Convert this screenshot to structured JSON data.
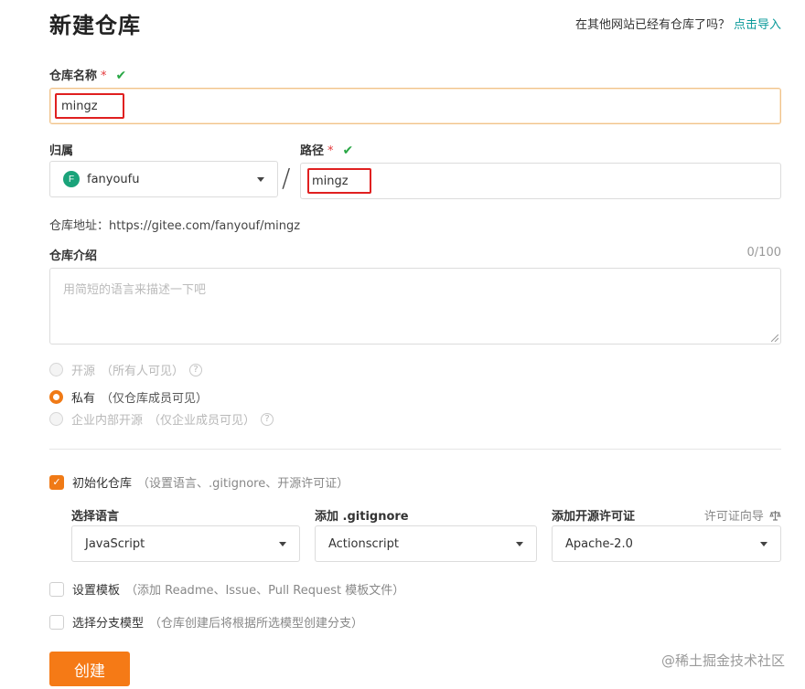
{
  "header": {
    "title": "新建仓库",
    "import_hint": "在其他网站已经有仓库了吗？",
    "import_link": "点击导入"
  },
  "repo_name": {
    "label": "仓库名称",
    "required_mark": "*",
    "valid_mark": "✔",
    "value": "mingz"
  },
  "owner": {
    "label": "归属",
    "avatar_letter": "F",
    "value": "fanyoufu"
  },
  "path_separator": "/",
  "path": {
    "label": "路径",
    "required_mark": "*",
    "valid_mark": "✔",
    "value": "mingz"
  },
  "address": {
    "label": "仓库地址：",
    "value": "https://gitee.com/fanyouf/mingz"
  },
  "intro": {
    "label": "仓库介绍",
    "counter": "0/100",
    "placeholder": "用简短的语言来描述一下吧"
  },
  "visibility": {
    "options": [
      {
        "label": "开源",
        "hint": "（所有人可见）",
        "state": "disabled",
        "has_help": true
      },
      {
        "label": "私有",
        "hint": "（仅仓库成员可见）",
        "state": "checked",
        "has_help": false
      },
      {
        "label": "企业内部开源",
        "hint": "（仅企业成员可见）",
        "state": "disabled",
        "has_help": true
      }
    ],
    "help_glyph": "?"
  },
  "init": {
    "label": "初始化仓库",
    "hint": "（设置语言、.gitignore、开源许可证）",
    "checked": true,
    "language": {
      "label": "选择语言",
      "value": "JavaScript"
    },
    "gitignore": {
      "label": "添加 .gitignore",
      "value": "Actionscript"
    },
    "license": {
      "label": "添加开源许可证",
      "value": "Apache-2.0",
      "guide": "许可证向导"
    }
  },
  "template": {
    "label": "设置模板",
    "hint": "（添加 Readme、Issue、Pull Request 模板文件）",
    "checked": false
  },
  "branch_model": {
    "label": "选择分支模型",
    "hint": "（仓库创建后将根据所选模型创建分支）",
    "checked": false
  },
  "submit": {
    "label": "创建"
  },
  "watermark": "@稀土掘金技术社区",
  "colors": {
    "accent": "#f57a16",
    "link": "#0a9a9a",
    "valid": "#29a745",
    "required": "#e4393c",
    "highlight_box": "#e02020"
  }
}
